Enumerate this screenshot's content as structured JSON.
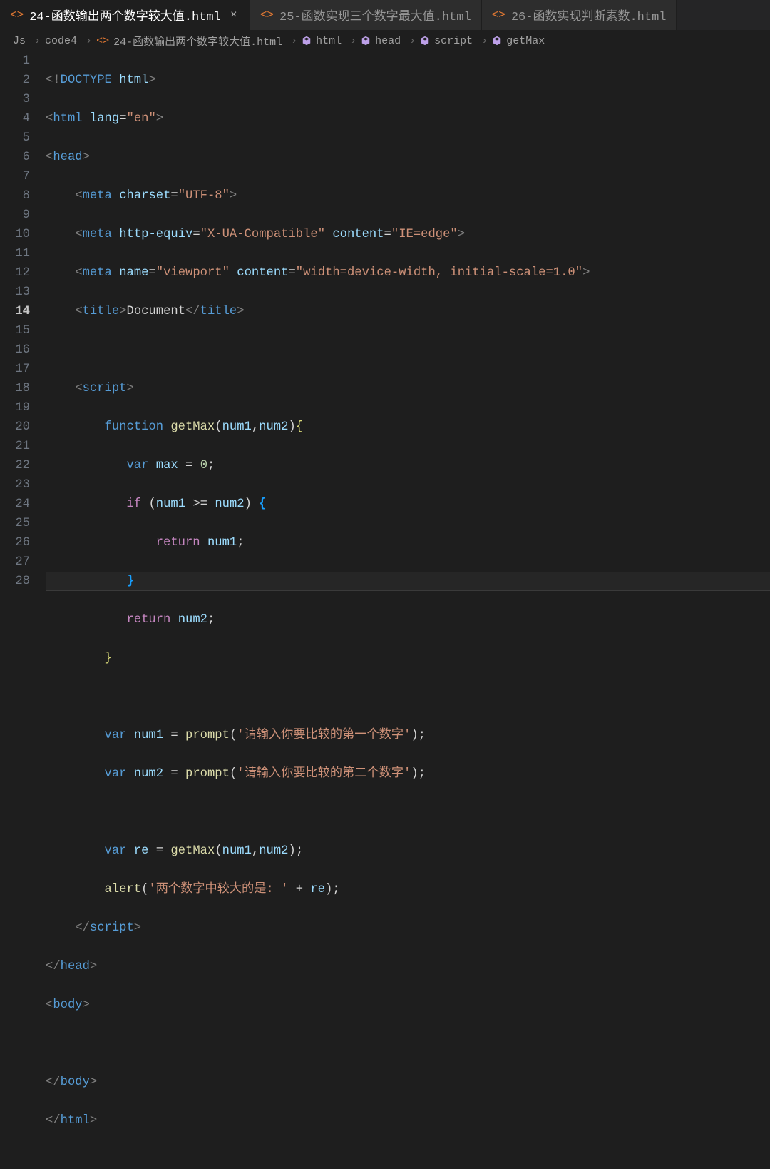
{
  "tabs": [
    {
      "label": "24-函数输出两个数字较大值.html",
      "active": true,
      "close": true
    },
    {
      "label": "25-函数实现三个数字最大值.html",
      "active": false,
      "close": false
    },
    {
      "label": "26-函数实现判断素数.html",
      "active": false,
      "close": false
    }
  ],
  "breadcrumbs": {
    "items": [
      {
        "label": "Js",
        "icon": ""
      },
      {
        "label": "code4",
        "icon": ""
      },
      {
        "label": "24-函数输出两个数字较大值.html",
        "icon": "html"
      },
      {
        "label": "html",
        "icon": "cube"
      },
      {
        "label": "head",
        "icon": "cube"
      },
      {
        "label": "script",
        "icon": "cube"
      },
      {
        "label": "getMax",
        "icon": "method"
      }
    ],
    "chevron": "›"
  },
  "current_line": 14,
  "line_count": 28,
  "code_tokens": {
    "doctype": "<!DOCTYPE ",
    "doctype_html": "html",
    "doctype_close": ">",
    "lang_attr": "lang",
    "lang_val": "\"en\"",
    "charset_attr": "charset",
    "charset_val": "\"UTF-8\"",
    "httpequiv_attr": "http-equiv",
    "httpequiv_val": "\"X-UA-Compatible\"",
    "content_attr": "content",
    "content_val1": "\"IE=edge\"",
    "name_attr": "name",
    "viewport_val": "\"viewport\"",
    "content_val2": "\"width=device-width, initial-scale=1.0\"",
    "title_text": "Document",
    "tag_html": "html",
    "tag_head": "head",
    "tag_meta": "meta",
    "tag_title": "title",
    "tag_script": "script",
    "tag_body": "body",
    "kw_function": "function",
    "fn_getMax": "getMax",
    "var_num1": "num1",
    "var_num2": "num2",
    "kw_var": "var",
    "var_max": "max",
    "num_0": "0",
    "kw_if": "if",
    "op_gte": ">=",
    "kw_return": "return",
    "fn_prompt": "prompt",
    "str_prompt1": "'请输入你要比较的第一个数字'",
    "str_prompt2": "'请输入你要比较的第二个数字'",
    "var_re": "re",
    "fn_alert": "alert",
    "str_alert": "'两个数字中较大的是: '",
    "op_plus": "+"
  }
}
